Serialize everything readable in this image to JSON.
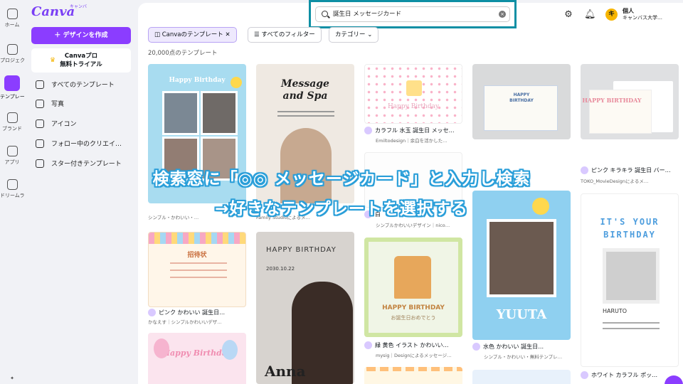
{
  "rail": [
    {
      "label": "ホーム",
      "icon": "home-icon"
    },
    {
      "label": "プロジェクト",
      "icon": "folder-icon"
    },
    {
      "label": "テンプレート",
      "icon": "template-icon",
      "active": true
    },
    {
      "label": "ブランド",
      "icon": "brand-icon"
    },
    {
      "label": "アプリ",
      "icon": "apps-icon"
    },
    {
      "label": "ドリームラボ",
      "icon": "dream-lab-icon"
    }
  ],
  "logo": {
    "text": "Canva",
    "sub": "キャンバ"
  },
  "panel": {
    "create_label": "＋ デザインを作成",
    "pro_line1": "Canvaプロ",
    "pro_line2": "無料トライアル",
    "nav": [
      {
        "label": "すべてのテンプレート",
        "icon": "all-templates-icon"
      },
      {
        "label": "写真",
        "icon": "photo-icon"
      },
      {
        "label": "アイコン",
        "icon": "shapes-icon"
      },
      {
        "label": "フォロー中のクリエイ…",
        "icon": "heart-icon"
      },
      {
        "label": "スター付きテンプレート",
        "icon": "star-icon"
      }
    ]
  },
  "search": {
    "value": "誕生日 メッセージカード",
    "clear": "×"
  },
  "header": {
    "settings_icon": "gear-icon",
    "bell_icon": "bell-icon",
    "avatar": "キ",
    "account_line1": "個人",
    "account_line2": "キャンバス大学…"
  },
  "filters": {
    "canva_templates": "Canvaのテンプレート",
    "all_filters": "すべてのフィルター",
    "category": "カテゴリー ⌄"
  },
  "result_count": "20,000点のテンプレート",
  "cards": [
    {
      "title": "Happy Birthday",
      "caption": "",
      "sub": "シンプル・かわいい・…"
    },
    {
      "title": "Message and Spa",
      "caption": "",
      "sub": "Family Studioによるメ…"
    },
    {
      "title": "Happy Birthday",
      "caption": "カラフル 水玉 誕生日 メッセ…",
      "sub": "Emiltodesign｜余白を活かした…"
    },
    {
      "title": "HAPPY BIRTHDAY",
      "caption": "",
      "sub": ""
    },
    {
      "title": "HAPPY BIRTHDAY",
      "caption": "ピンク キラキラ 誕生日 バー…",
      "sub": "TOKO_MovieDesignによるメ…"
    },
    {
      "title": "招待状",
      "caption": "ピンク かわいい 誕生日…",
      "sub": "かなえす｜シンプルかわいいデザ…"
    },
    {
      "title": "HAPPY BIRTHDAY",
      "date": "2030.10.22",
      "name": "Anna",
      "caption": "",
      "sub": ""
    },
    {
      "title": "HAPPY BIRTHDAY",
      "message": "お誕生日おめでとう",
      "caption": "緑 黄色 イラスト かわいい…",
      "sub": "mysig｜Designによるメッセージ…"
    },
    {
      "title": "YUUTA",
      "caption": "水色 かわいい 誕生日…",
      "sub": "シンプル・かわいい・無料テンプレ…"
    },
    {
      "title": "IT'S YOUR BIRTHDAY",
      "name": "HARUTO",
      "caption": "ホワイト カラフル ポッ…",
      "sub": ""
    },
    {
      "title": "Happy Birthday",
      "caption": "",
      "sub": ""
    },
    {
      "title": "",
      "caption": "白",
      "sub": "シンプルかわいいデザイン｜nico…"
    }
  ],
  "overlay": {
    "line1": "検索窓に「◎◎ メッセージカード」と入力し検索",
    "line2": "→好きなテンプレートを選択する"
  }
}
